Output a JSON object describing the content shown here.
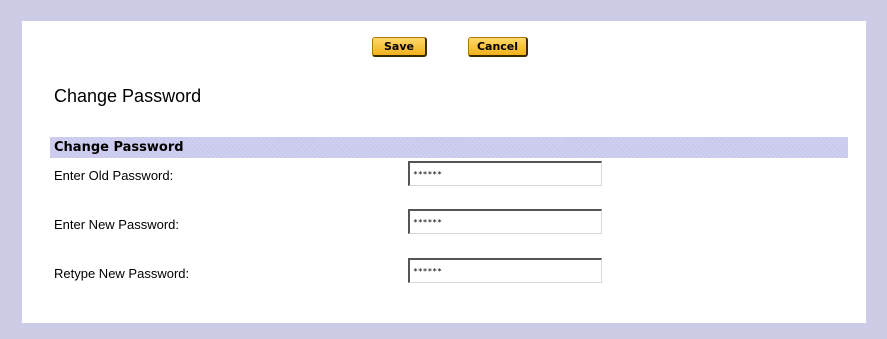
{
  "toolbar": {
    "save_label": "Save",
    "cancel_label": "Cancel"
  },
  "page": {
    "title": "Change Password"
  },
  "section": {
    "header": "Change Password",
    "fields": [
      {
        "label": "Enter Old Password:",
        "value": "******"
      },
      {
        "label": "Enter New Password:",
        "value": "******"
      },
      {
        "label": "Retype New Password:",
        "value": "******"
      }
    ]
  },
  "colors": {
    "frame_background": "#cccce6",
    "section_header": "#c9c9ee",
    "button_fill": "#f2b21c"
  }
}
